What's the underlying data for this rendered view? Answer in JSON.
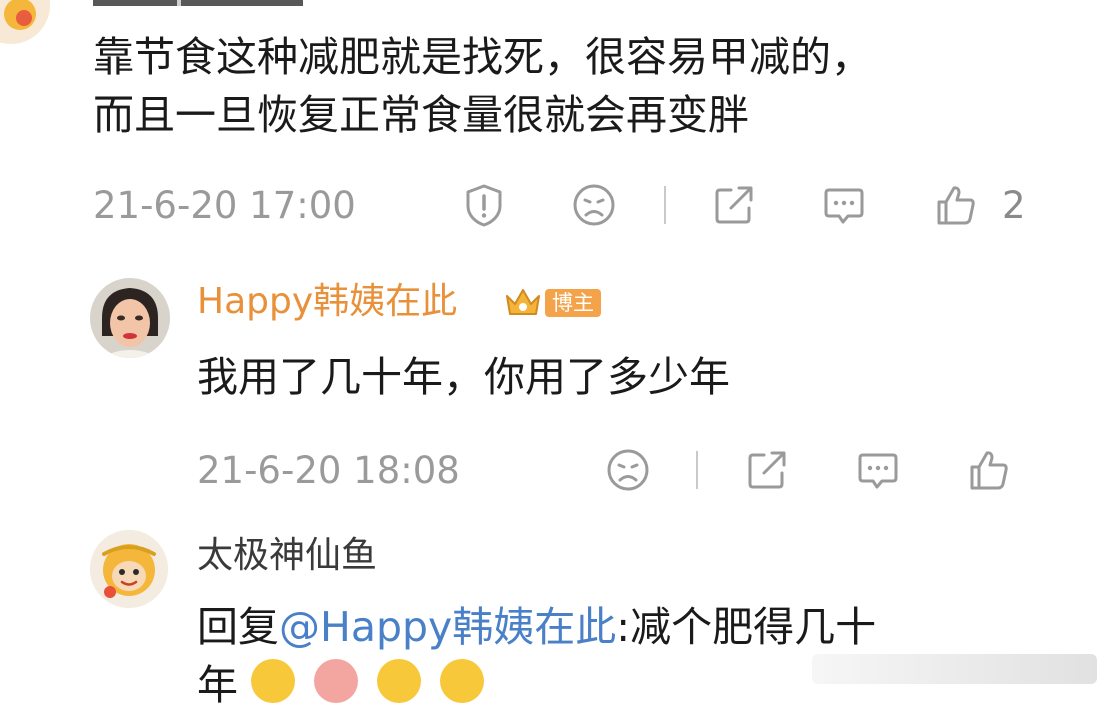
{
  "comments": [
    {
      "text_lines": [
        "靠节食这种减肥就是找死，很容易甲减的，",
        "而且一旦恢复正常食量很就会再变胖"
      ],
      "time": "21-6-20 17:00",
      "like_count": "2"
    },
    {
      "username": "Happy韩姨在此",
      "username_color": "#e8913a",
      "badge": "博主",
      "text": "我用了几十年，你用了多少年",
      "time": "21-6-20 18:08"
    },
    {
      "username": "太极神仙鱼",
      "reply_prefix": "回复",
      "mention": "@Happy韩姨在此",
      "reply_text": ":减个肥得几十",
      "reply_text_line2": "年"
    }
  ],
  "colors": {
    "text": "#1a1a1a",
    "meta": "#9a9a9a",
    "mention": "#4a80c7",
    "badge": "#f4a34a"
  },
  "icons": {
    "report": "report-icon",
    "dislike": "dislike-icon",
    "share": "share-icon",
    "comment": "comment-icon",
    "like": "like-icon"
  }
}
